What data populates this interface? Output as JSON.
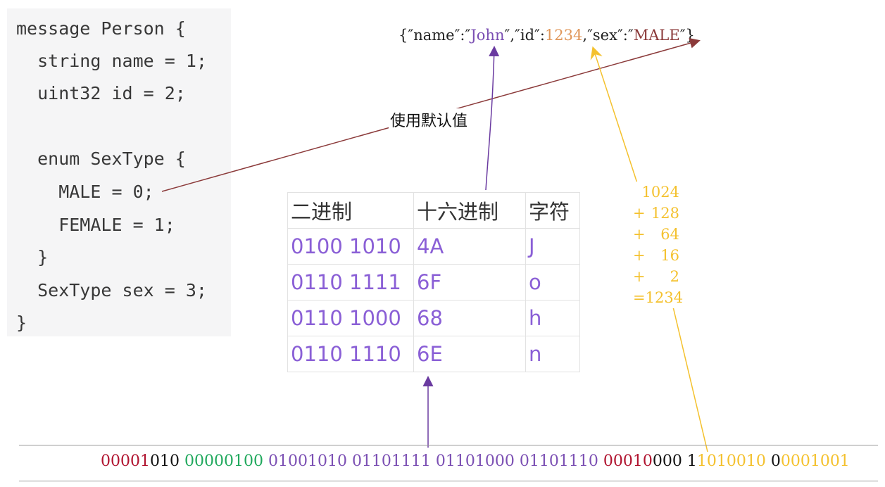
{
  "code": {
    "lines": [
      "message Person {",
      "  string name = 1;",
      "  uint32 id = 2;",
      "",
      "  enum SexType {",
      "    MALE = 0;",
      "    FEMALE = 1;",
      "  }",
      "  SexType sex = 3;",
      "}"
    ]
  },
  "json": {
    "p1": "{″name″:″",
    "name_value": "John",
    "p2": "″,″id″:",
    "id_value": "1234",
    "p3": ",″sex″:″",
    "sex_value": "MALE",
    "p4": "″}"
  },
  "annotation": {
    "default_value": "使用默认值"
  },
  "table": {
    "headers": [
      "二进制",
      "十六进制",
      "字符"
    ],
    "rows": [
      [
        "0100 1010",
        "4A",
        "J"
      ],
      [
        "0110 1111",
        "6F",
        "o"
      ],
      [
        "0110 1000",
        "68",
        "h"
      ],
      [
        "0110 1110",
        "6E",
        "n"
      ]
    ]
  },
  "sum": {
    "lines": [
      [
        "",
        "1024"
      ],
      [
        "+",
        "128"
      ],
      [
        "+",
        "64"
      ],
      [
        "+",
        "16"
      ],
      [
        "+",
        "2"
      ],
      [
        "=",
        "1234"
      ]
    ]
  },
  "binary": {
    "segments": [
      {
        "text": "00001",
        "color": "red"
      },
      {
        "text": "010 ",
        "color": "black"
      },
      {
        "text": "00000100 ",
        "color": "green"
      },
      {
        "text": "01001010 01101111 01101000 01101110 ",
        "color": "purple"
      },
      {
        "text": "00010",
        "color": "red"
      },
      {
        "text": "000 ",
        "color": "black"
      },
      {
        "text": "1",
        "color": "black"
      },
      {
        "text": "1010010 ",
        "color": "yellow"
      },
      {
        "text": "0",
        "color": "black"
      },
      {
        "text": "0001001",
        "color": "yellow"
      }
    ]
  },
  "colors": {
    "purple": "#7b4fb3",
    "orange": "#e0975a",
    "dark_red": "#8b3a3a",
    "yellow": "#f4c12e",
    "green": "#1fa85c",
    "red": "#b0122e"
  }
}
